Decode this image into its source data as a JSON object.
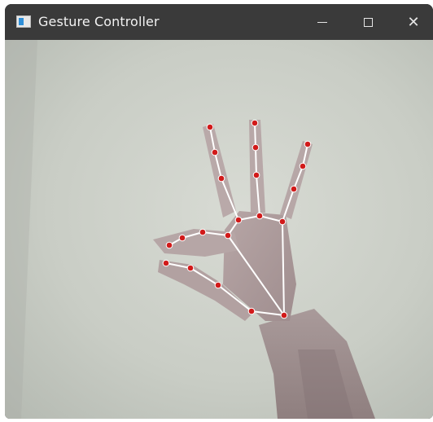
{
  "window": {
    "title": "Gesture Controller",
    "app_icon": "window-app-icon",
    "controls": {
      "minimize_icon": "minimize-icon",
      "maximize_icon": "maximize-icon",
      "close_icon": "close-icon",
      "close_glyph": "✕"
    }
  },
  "camera": {
    "landmark_color": "#d11a1a",
    "connection_color": "#ffffff",
    "background_color": "#c9ccc4"
  }
}
